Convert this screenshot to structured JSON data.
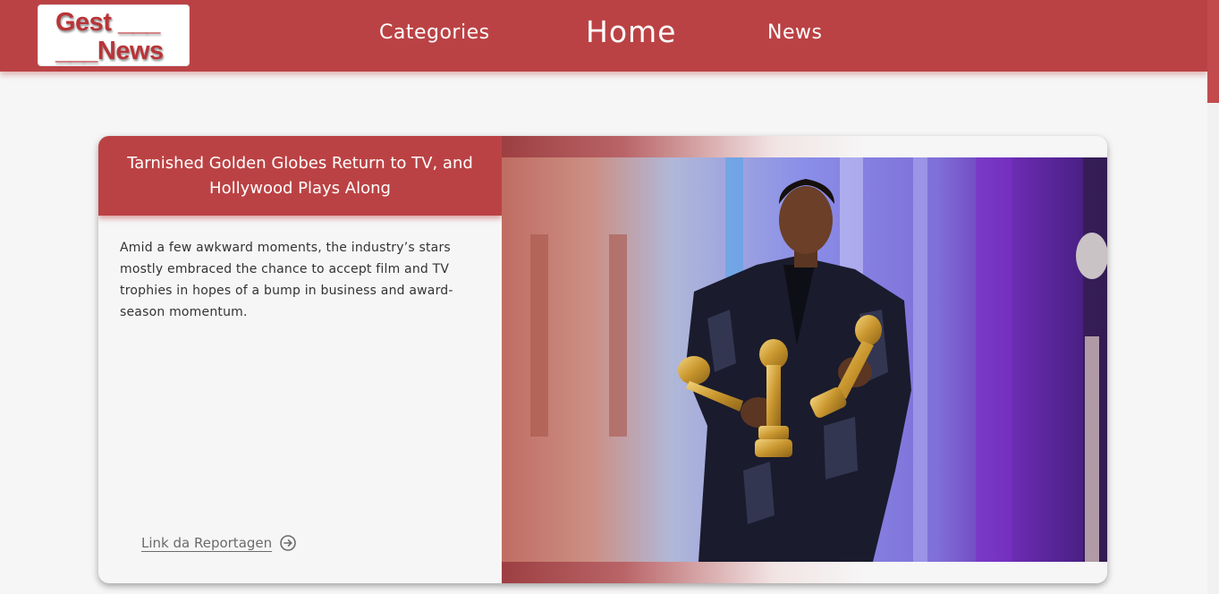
{
  "header": {
    "logo": {
      "line1": "Gest ___",
      "line2": "___News"
    },
    "nav": {
      "categories": "Categories",
      "home": "Home",
      "news": "News"
    },
    "colors": {
      "bar": "#bb4244",
      "logo_text": "#b93438"
    }
  },
  "article": {
    "title": "Tarnished Golden Globes Return to TV, and Hollywood Plays Along",
    "description": "Amid a few awkward moments, the industry’s stars mostly embraced the chance to accept film and TV trophies in hopes of a bump in business and award-season momentum.",
    "link_label": "Link da Reportagen",
    "link_icon": "arrow-circle-right-icon",
    "image_icon": "photo-man-holding-golden-globe-trophies"
  }
}
